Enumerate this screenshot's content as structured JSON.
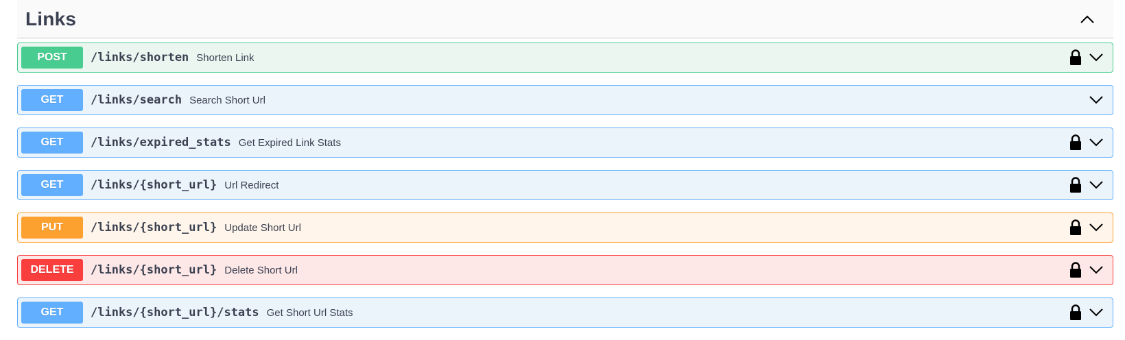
{
  "section": {
    "title": "Links"
  },
  "operations": [
    {
      "method": "POST",
      "path": "/links/shorten",
      "summary": "Shorten Link",
      "locked": true
    },
    {
      "method": "GET",
      "path": "/links/search",
      "summary": "Search Short Url",
      "locked": false
    },
    {
      "method": "GET",
      "path": "/links/expired_stats",
      "summary": "Get Expired Link Stats",
      "locked": true
    },
    {
      "method": "GET",
      "path": "/links/{short_url}",
      "summary": "Url Redirect",
      "locked": true
    },
    {
      "method": "PUT",
      "path": "/links/{short_url}",
      "summary": "Update Short Url",
      "locked": true
    },
    {
      "method": "DELETE",
      "path": "/links/{short_url}",
      "summary": "Delete Short Url",
      "locked": true
    },
    {
      "method": "GET",
      "path": "/links/{short_url}/stats",
      "summary": "Get Short Url Stats",
      "locked": true
    }
  ],
  "icons": {
    "collapse": "chevron-up-icon",
    "expand": "chevron-down-icon",
    "auth": "lock-icon"
  },
  "colors": {
    "post": "#49cc90",
    "get": "#61affe",
    "put": "#fca130",
    "delete": "#f93e3e",
    "text": "#3b4151"
  }
}
